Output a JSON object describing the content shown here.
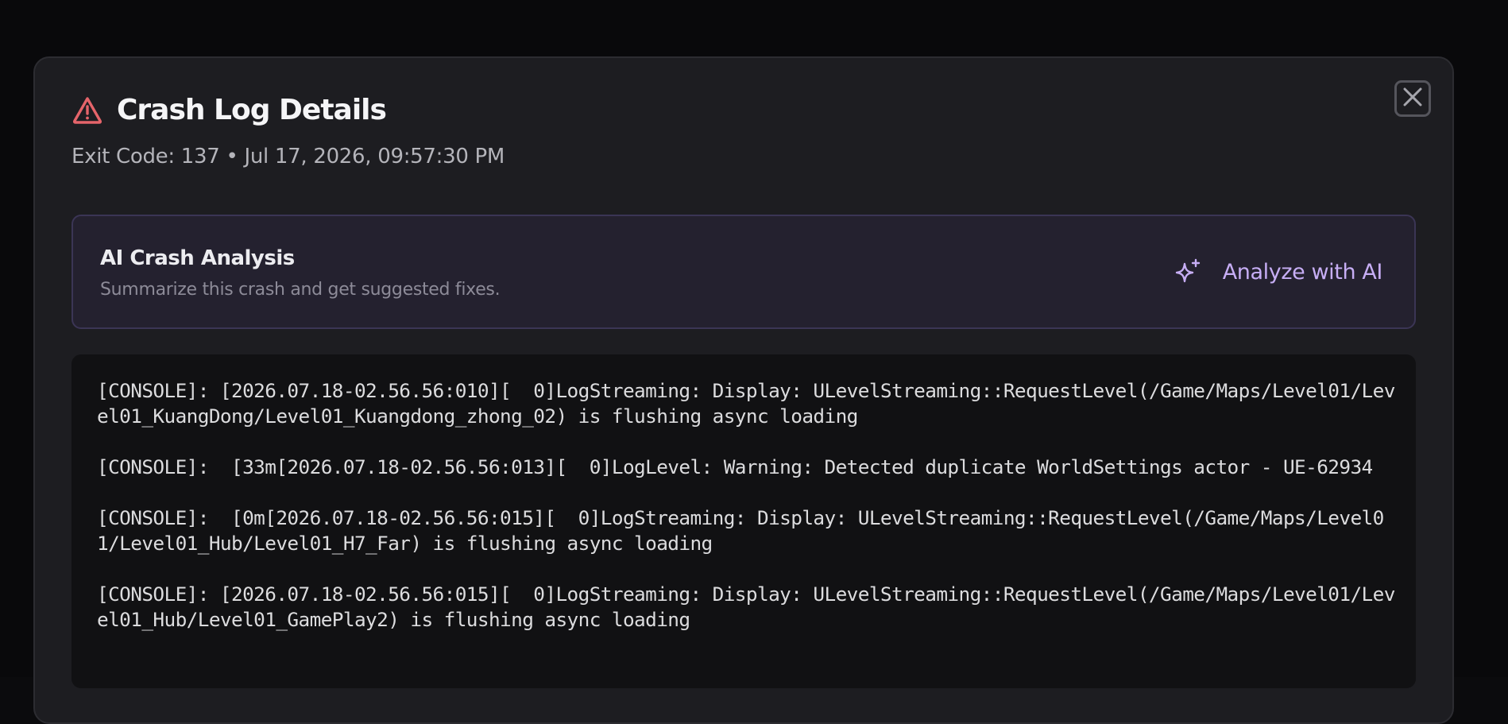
{
  "dialog": {
    "title": "Crash Log Details",
    "subtitle": "Exit Code: 137 • Jul 17, 2026, 09:57:30 PM",
    "close_icon": "close-icon",
    "warning_icon": "warning-triangle-icon"
  },
  "ai_analysis": {
    "title": "AI Crash Analysis",
    "description": "Summarize this crash and get suggested fixes.",
    "button_label": "Analyze with AI",
    "button_icon": "sparkles-icon",
    "accent_color": "#c7aef5"
  },
  "log": {
    "lines": [
      "[CONSOLE]: [2026.07.18-02.56.56:010][  0]LogStreaming: Display: ULevelStreaming::RequestLevel(/Game/Maps/Level01/Level01_KuangDong/Level01_Kuangdong_zhong_02) is flushing async loading",
      "[CONSOLE]:  [33m[2026.07.18-02.56.56:013][  0]LogLevel: Warning: Detected duplicate WorldSettings actor - UE-62934",
      "[CONSOLE]:  [0m[2026.07.18-02.56.56:015][  0]LogStreaming: Display: ULevelStreaming::RequestLevel(/Game/Maps/Level01/Level01_Hub/Level01_H7_Far) is flushing async loading",
      "[CONSOLE]: [2026.07.18-02.56.56:015][  0]LogStreaming: Display: ULevelStreaming::RequestLevel(/Game/Maps/Level01/Level01_Hub/Level01_GamePlay2) is flushing async loading"
    ]
  },
  "colors": {
    "warning": "#e5646a",
    "background": "#1d1d21"
  }
}
